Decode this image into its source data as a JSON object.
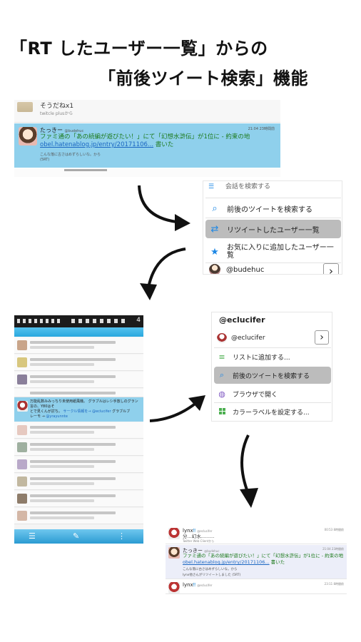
{
  "headline": {
    "line1": "「RT したユーザー一覧」からの",
    "line2": "「前後ツイート検索」機能"
  },
  "panel_tweet": {
    "top_text": "そうだねx1",
    "top_source": "twitcle plusから",
    "user_name": "たっきー",
    "user_handle": "@budehuc",
    "time": "21:04 23時間前",
    "body_line1": "ファミ通の「あの続編が遊びたい！」にて「幻想水滸伝」が1位に - 約束の地",
    "body_link": "obel.hatenablog.jp/entry/20171106...",
    "body_suffix": " 書いた",
    "rt_line": "こんな落に古さはめずらしいな。から",
    "rt_count": "(5RT)"
  },
  "panel_rt_menu": {
    "cut_item": "会話を検索する",
    "items": [
      {
        "label": "前後のツイートを検索する",
        "icon": "search-icon"
      },
      {
        "label": "リツイートしたユーザー一覧",
        "icon": "retweet-icon"
      },
      {
        "label_line1": "お気に入りに追加したユーザー一",
        "label_line2": "覧",
        "icon": "star-icon"
      },
      {
        "label": "@budehuc",
        "icon": "avatar"
      }
    ],
    "chevron": "›"
  },
  "panel_timeline": {
    "clock": "4",
    "highlighted_text_line1": "万能乱数みみっちり未使用紙風機。 グラブルはレシ手放しのグラン言の、Y80はそ",
    "highlighted_text_line2": "とで見くんが討ち。",
    "highlighted_link": "サークル情報を→ @eclucifer",
    "highlighted_text_line3": "グラブルブ",
    "highlighted_text_line4": "レーモ → ",
    "highlighted_link2": "@yrayunnte"
  },
  "panel_user_menu": {
    "title": "@eclucifer",
    "items": [
      {
        "label": "@eclucifer",
        "icon": "avatar"
      },
      {
        "label": "リストに追加する...",
        "icon": "list-add-icon"
      },
      {
        "label": "前後のツイートを検索する",
        "icon": "search-icon"
      },
      {
        "label": "ブラウザで開く",
        "icon": "globe-icon"
      },
      {
        "label": "カラーラベルを設定する...",
        "icon": "color-label-icon"
      }
    ],
    "chevron": "›"
  },
  "panel_result": {
    "row1": {
      "name": "lynx",
      "badge": "‼",
      "handle": "@eclucifer",
      "time": "00:53 8時間前",
      "text": "分...幻水.........",
      "via": "Twitter Web Clientから"
    },
    "row2": {
      "name": "たっきー",
      "handle": "@budehuc",
      "time": "21:04 23時間前",
      "text_line1": "ファミ通の「あの続編が遊びたい！」にて「幻想水滸伝」が1位に - 約束の地",
      "link": "obel.hatenablog.jp/entry/20171106...",
      "suffix": " 書いた",
      "note1": "こんな落に古さはめずらしいな。から",
      "note2": "lynx他さんがリツイートしました (5RT)"
    },
    "row3": {
      "name": "lynx",
      "badge": "‼",
      "handle": "@eclucifer",
      "time": "23:11 8時間前"
    }
  },
  "colors": {
    "highlight_blue": "#8fd0ec",
    "menu_selected": "#bcbcbc",
    "tweet_text_green": "#1c7a1c",
    "link_blue": "#1a66c2",
    "icon_blue": "#1e88e5"
  }
}
